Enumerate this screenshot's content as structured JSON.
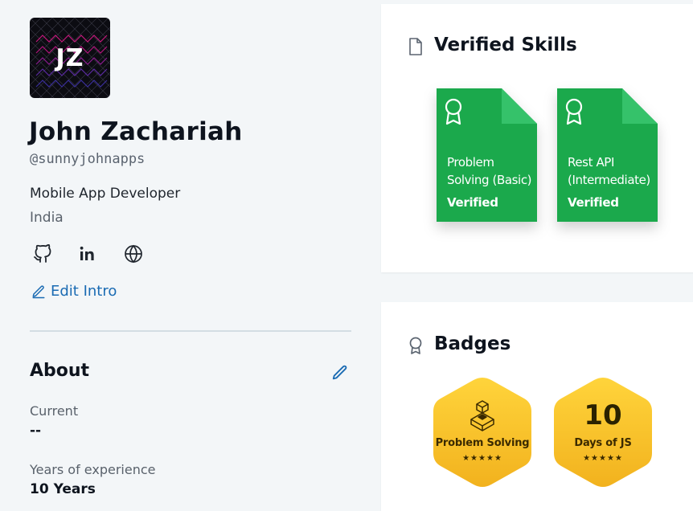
{
  "profile": {
    "initials": "JZ",
    "name": "John Zachariah",
    "handle": "@sunnyjohnapps",
    "role": "Mobile App Developer",
    "country": "India",
    "social_icons": [
      "github-icon",
      "linkedin-icon",
      "globe-icon"
    ],
    "edit_intro_label": "Edit Intro"
  },
  "about": {
    "title": "About",
    "fields": [
      {
        "label": "Current",
        "value": "--"
      },
      {
        "label": "Years of experience",
        "value": "10 Years"
      }
    ]
  },
  "verified_skills": {
    "title": "Verified Skills",
    "items": [
      {
        "name_line1": "Problem",
        "name_line2": "Solving (Basic)",
        "status": "Verified"
      },
      {
        "name_line1": "Rest API",
        "name_line2": "(Intermediate)",
        "status": "Verified"
      }
    ]
  },
  "badges": {
    "title": "Badges",
    "items": [
      {
        "title": "Problem Solving",
        "stars": "★★★★★",
        "rating": 5,
        "icon": "cube-stack-icon"
      },
      {
        "number": "10",
        "title": "Days of JS",
        "stars": "★★★★★",
        "rating": 5
      }
    ]
  },
  "colors": {
    "link": "#1a6bb3",
    "skill_green": "#1ba94c",
    "skill_fold": "#35c26a",
    "badge_gold": "#f5c22b"
  }
}
